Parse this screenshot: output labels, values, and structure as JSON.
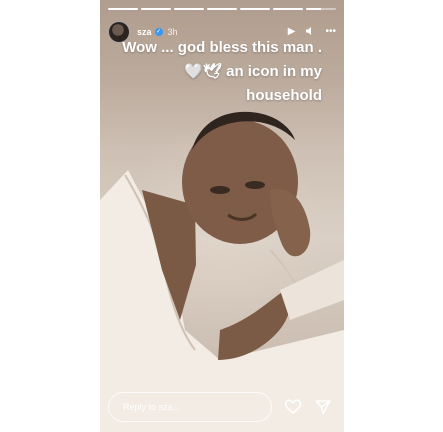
{
  "story": {
    "username": "sza",
    "time_ago": "3h",
    "progress": [
      1,
      1,
      1,
      1,
      1,
      1,
      0.5
    ],
    "caption": "Wow ... god bless this man . 🤍🕊 an icon in my household",
    "reply_placeholder": "Reply to sza...",
    "icons": {
      "play": "play-icon",
      "mute": "speaker-icon",
      "more": "more-icon",
      "like": "heart-icon",
      "share": "send-icon"
    },
    "colors": {
      "verified": "#3897f0",
      "text": "#ffffff"
    }
  }
}
